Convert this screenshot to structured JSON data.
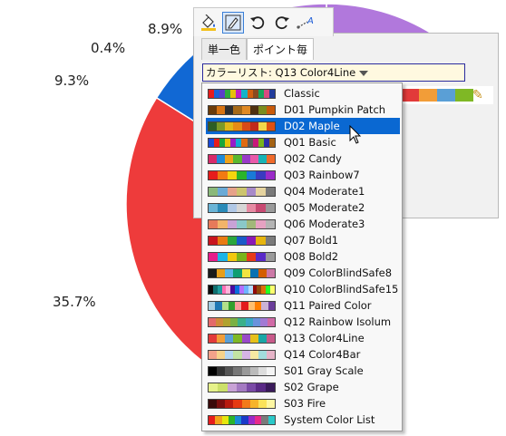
{
  "pie": {
    "labels": [
      "8.9%",
      "0.4%",
      "9.3%",
      "35.7%"
    ],
    "colors": {
      "purple": "#b178dc",
      "green": "#5ab864",
      "blue": "#1168d4",
      "red": "#ee3b3b"
    }
  },
  "toolbar": {
    "icons": [
      "fill-bucket-icon",
      "pen-edit-icon",
      "undo-icon",
      "redo-icon",
      "line-text-icon"
    ]
  },
  "tabs": [
    "単一色",
    "ポイント毎"
  ],
  "combo": {
    "label": "カラーリスト: Q13 Color4Line"
  },
  "preview_colors": [
    "#e23a3a",
    "#f29d38",
    "#5a9fd6",
    "#7fb825"
  ],
  "dropdown": {
    "items": [
      {
        "label": "Classic",
        "colors": [
          "#e61c1c",
          "#1a62d6",
          "#5c3ec8",
          "#2eaa3c",
          "#e6c00a",
          "#c020c0",
          "#12b4c8",
          "#d06010",
          "#8a4a20",
          "#18a45c",
          "#d84a80",
          "#223c9c"
        ]
      },
      {
        "label": "D01 Pumpkin Patch",
        "colors": [
          "#6a3c0a",
          "#d87412",
          "#2e2e2e",
          "#a66a18",
          "#e08a24",
          "#4e3010",
          "#7a8c1e",
          "#c85a0a"
        ]
      },
      {
        "label": "D02 Maple",
        "colors": [
          "#2d5e26",
          "#7c9a28",
          "#e0b81a",
          "#e68c16",
          "#d84a18",
          "#c02a1a",
          "#f2d64a",
          "#e05010"
        ]
      },
      {
        "label": "Q01 Basic",
        "colors": [
          "#1a4ad8",
          "#e61c1c",
          "#1aa63c",
          "#e6c20a",
          "#9a1cc8",
          "#14aad2",
          "#e06a12",
          "#5a5a5a",
          "#c8187a",
          "#7ab41a",
          "#2e2ea6",
          "#a46214"
        ]
      },
      {
        "label": "Q02 Candy",
        "colors": [
          "#d82a6a",
          "#1e8ad8",
          "#f0a21a",
          "#5ab82e",
          "#9a3ac8",
          "#e85aa8",
          "#18b4b4",
          "#f06a2a"
        ]
      },
      {
        "label": "Q03 Rainbow7",
        "colors": [
          "#e61c1c",
          "#f27a12",
          "#f6d40e",
          "#2ab42a",
          "#1a7ad6",
          "#3a3ac0",
          "#9a2ac8"
        ]
      },
      {
        "label": "Q04 Moderate1",
        "colors": [
          "#8ab87a",
          "#6aaad6",
          "#e6a28a",
          "#ccc46e",
          "#a88ac8",
          "#e6d4a0",
          "#7a7a7a"
        ]
      },
      {
        "label": "Q05 Moderate2",
        "colors": [
          "#6ab4d6",
          "#2a8ab8",
          "#b0c8e6",
          "#d6d6d6",
          "#e68aa2",
          "#c84a72",
          "#9a9a9a"
        ]
      },
      {
        "label": "Q06 Moderate3",
        "colors": [
          "#e67a5a",
          "#f2b46a",
          "#c8a2d6",
          "#8ac8c8",
          "#a2b87a",
          "#e6a2c2",
          "#b4b4b4"
        ]
      },
      {
        "label": "Q07 Bold1",
        "colors": [
          "#c8141e",
          "#e87a12",
          "#2aa63c",
          "#1a5ac8",
          "#8a1ab4",
          "#e6b40e",
          "#7a7a7a"
        ]
      },
      {
        "label": "Q08 Bold2",
        "colors": [
          "#e61c8a",
          "#1ab4e6",
          "#f2c80e",
          "#7ab41a",
          "#e63a1a",
          "#5a2ac8",
          "#9a9a9a"
        ]
      },
      {
        "label": "Q09 ColorBlindSafe8",
        "colors": [
          "#1a1a1a",
          "#e69e1a",
          "#58b4e6",
          "#0e9e72",
          "#f2e442",
          "#0a72b2",
          "#d45e00",
          "#cc79a7"
        ]
      },
      {
        "label": "Q10 ColorBlindSafe15",
        "colors": [
          "#0a0a0a",
          "#0e6e6e",
          "#1e9e9e",
          "#ff6eb4",
          "#ffb4dc",
          "#4a0a9e",
          "#0a6edc",
          "#b46eff",
          "#6eb4ff",
          "#b4dcff",
          "#920a0a",
          "#924a0a",
          "#dc6e0a",
          "#24fe24",
          "#fefe6e"
        ]
      },
      {
        "label": "Q11 Paired Color",
        "colors": [
          "#a6cee3",
          "#1f78b4",
          "#b2df8a",
          "#33a02c",
          "#fb9a99",
          "#e31a1c",
          "#fdbf6f",
          "#ff7f00",
          "#cab2d6",
          "#6a3d9a"
        ]
      },
      {
        "label": "Q12 Rainbow Isolum",
        "colors": [
          "#e46a6a",
          "#d08a3a",
          "#b0a22e",
          "#7ab044",
          "#3ab08a",
          "#3aa6c4",
          "#6a92dc",
          "#a27ad4",
          "#d06aa6"
        ]
      },
      {
        "label": "Q13 Color4Line",
        "colors": [
          "#e23a3a",
          "#f29d38",
          "#5a9fd6",
          "#7fb825",
          "#9a4ac8",
          "#e6c01a",
          "#1aa6a6",
          "#c85a8a"
        ]
      },
      {
        "label": "Q14 Color4Bar",
        "colors": [
          "#f2a28a",
          "#f6d28a",
          "#b4d6f2",
          "#c2e2a2",
          "#d6b4e6",
          "#f6eaa2",
          "#a2dcdc",
          "#e6b4c8"
        ]
      },
      {
        "label": "S01 Gray Scale",
        "colors": [
          "#000000",
          "#333333",
          "#555555",
          "#777777",
          "#999999",
          "#bbbbbb",
          "#dddddd",
          "#f4f4f4"
        ]
      },
      {
        "label": "S02 Grape",
        "colors": [
          "#e6f28a",
          "#cce06a",
          "#c8a2d6",
          "#a47ac2",
          "#7a4aa6",
          "#5a2a86",
          "#3a1a5a"
        ]
      },
      {
        "label": "S03 Fire",
        "colors": [
          "#3a0a0a",
          "#7a0e0e",
          "#b81a0e",
          "#e63a12",
          "#f27a1a",
          "#f6b42a",
          "#fae25a",
          "#fdf6a2"
        ]
      },
      {
        "label": "System Color List",
        "colors": [
          "#e61c1c",
          "#f2a21a",
          "#e6e60e",
          "#2ab42a",
          "#1a8ad6",
          "#1a3ac8",
          "#9a2ac8",
          "#e62a8a",
          "#7a7a7a",
          "#2ac8c8"
        ]
      }
    ],
    "highlighted_index": 2
  }
}
